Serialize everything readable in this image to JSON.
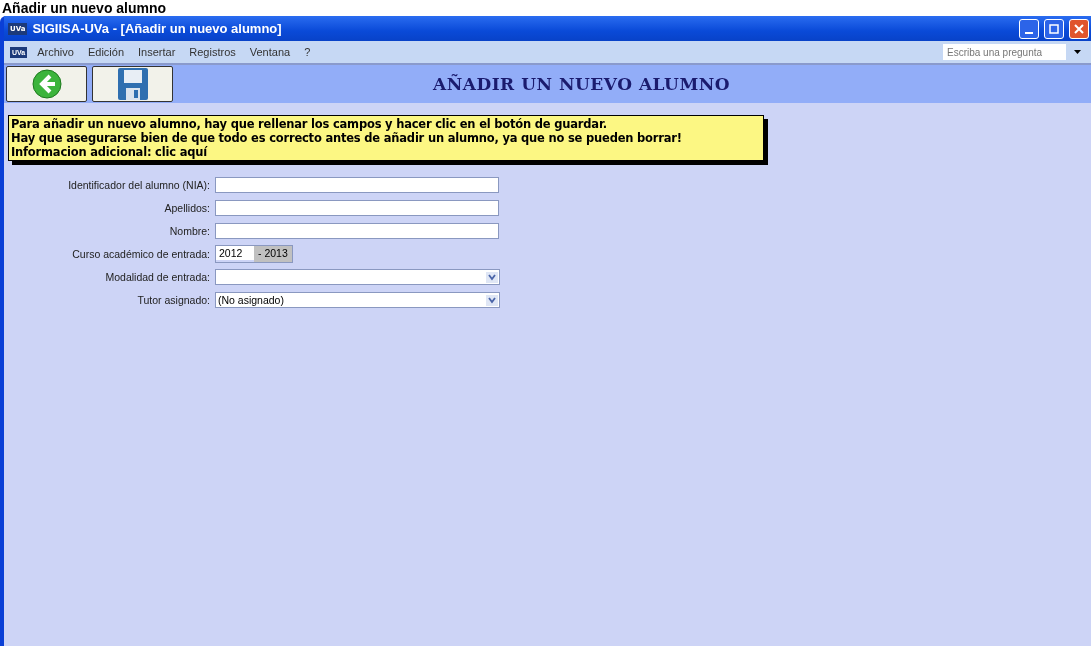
{
  "page_heading": "Añadir un nuevo alumno",
  "window": {
    "title": "SIGIISA-UVa - [Añadir un nuevo alumno]",
    "app_badge": "UVa"
  },
  "menu_bar": {
    "badge": "UVa",
    "items": [
      "Archivo",
      "Edición",
      "Insertar",
      "Registros",
      "Ventana",
      "?"
    ],
    "help_search": {
      "placeholder": "Escriba una pregunta"
    }
  },
  "form_header": {
    "title": "AÑADIR UN NUEVO ALUMNO"
  },
  "notice": [
    "Para añadir un nuevo alumno, hay que rellenar los campos y hacer clic en el botón de guardar.",
    "Hay que asegurarse bien de que todo es correcto antes de añadir un alumno, ya que no se pueden borrar!",
    "Informacion adicional: clic aquí"
  ],
  "fields": [
    {
      "kind": "text",
      "label": "Identificador del alumno (NIA):"
    },
    {
      "kind": "text",
      "label": "Apellidos:"
    },
    {
      "kind": "text",
      "label": "Nombre:"
    },
    {
      "kind": "year",
      "label": "Curso académico de entrada:",
      "value": "2012",
      "suffix": "- 2013"
    },
    {
      "kind": "select",
      "label": "Modalidad de entrada:"
    },
    {
      "kind": "select",
      "label": "Tutor asignado:",
      "value": "(No asignado)"
    }
  ]
}
